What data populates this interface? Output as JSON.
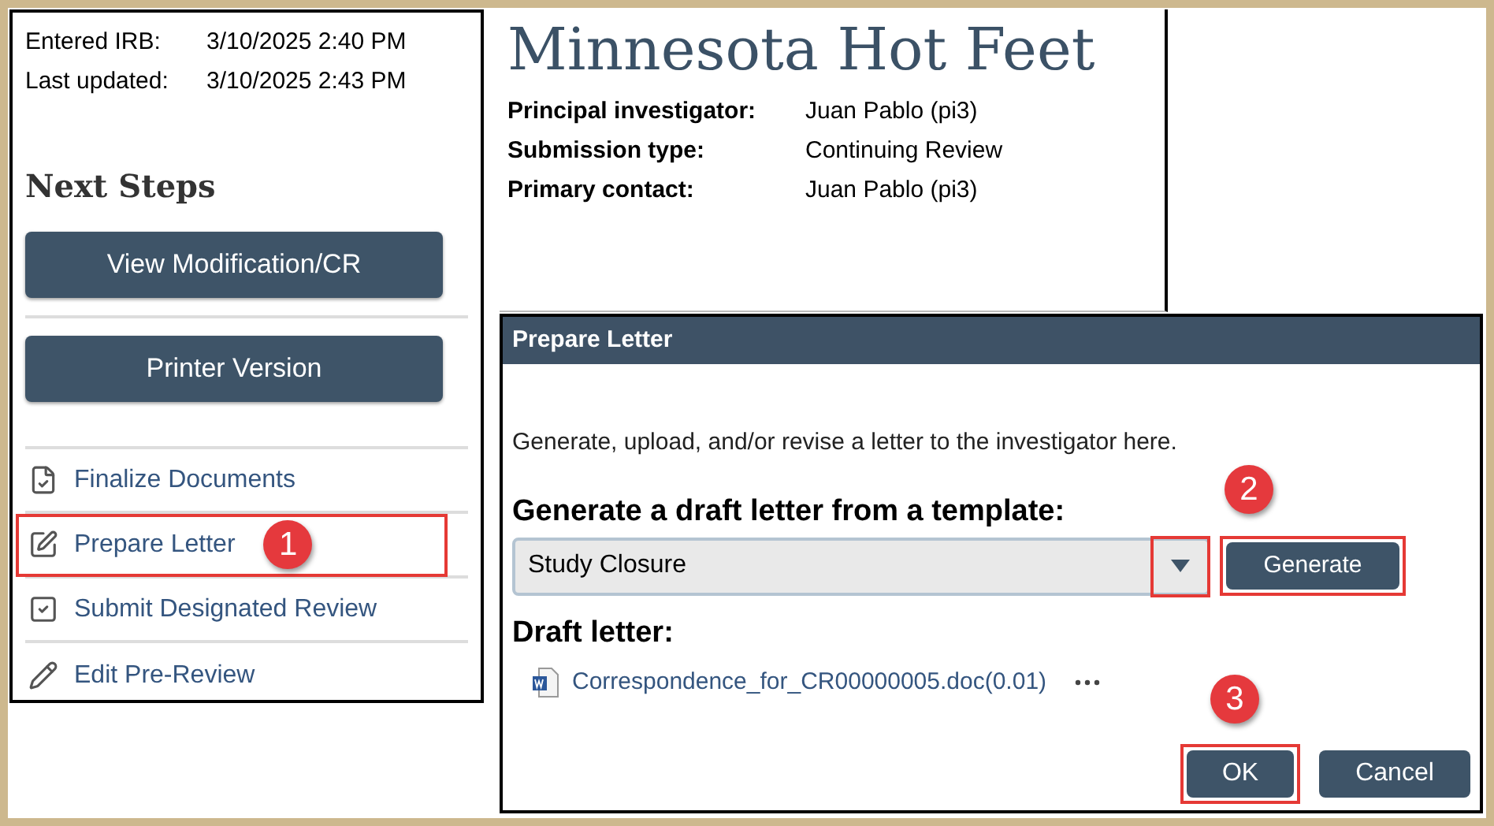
{
  "summary": {
    "dates": [
      {
        "label": "Entered IRB:",
        "value": "3/10/2025 2:40 PM"
      },
      {
        "label": "Last updated:",
        "value": "3/10/2025 2:43 PM"
      }
    ],
    "heading": "Next Steps",
    "buttons": [
      "View Modification/CR",
      "Printer Version"
    ],
    "activities": [
      {
        "label": "Finalize Documents",
        "kind": "document",
        "highlighted": false
      },
      {
        "label": "Prepare Letter",
        "kind": "edit",
        "highlighted": true,
        "callout": "1"
      },
      {
        "label": "Submit Designated Review",
        "kind": "check",
        "highlighted": false
      },
      {
        "label": "Edit Pre-Review",
        "kind": "pencil",
        "highlighted": false
      }
    ]
  },
  "study": {
    "title": "Minnesota Hot Feet",
    "fields": [
      {
        "label": "Principal investigator:",
        "value": "Juan Pablo (pi3)"
      },
      {
        "label": "Submission type:",
        "value": "Continuing Review"
      },
      {
        "label": "Primary contact:",
        "value": "Juan Pablo (pi3)"
      }
    ]
  },
  "dialog": {
    "title": "Prepare Letter",
    "intro": "Generate, upload, and/or revise a letter to the investigator here.",
    "template_label": "Generate a draft letter from a template:",
    "template": {
      "value": "Study Closure",
      "arrow_highlighted": true
    },
    "generate": {
      "label": "Generate",
      "highlighted": true,
      "callout": "2"
    },
    "draft_label": "Draft letter:",
    "draft_file": "Correspondence_for_CR00000005.doc(0.01)",
    "buttons": [
      {
        "label": "OK",
        "highlighted": true,
        "callout": "3"
      },
      {
        "label": "Cancel",
        "highlighted": false
      }
    ]
  }
}
